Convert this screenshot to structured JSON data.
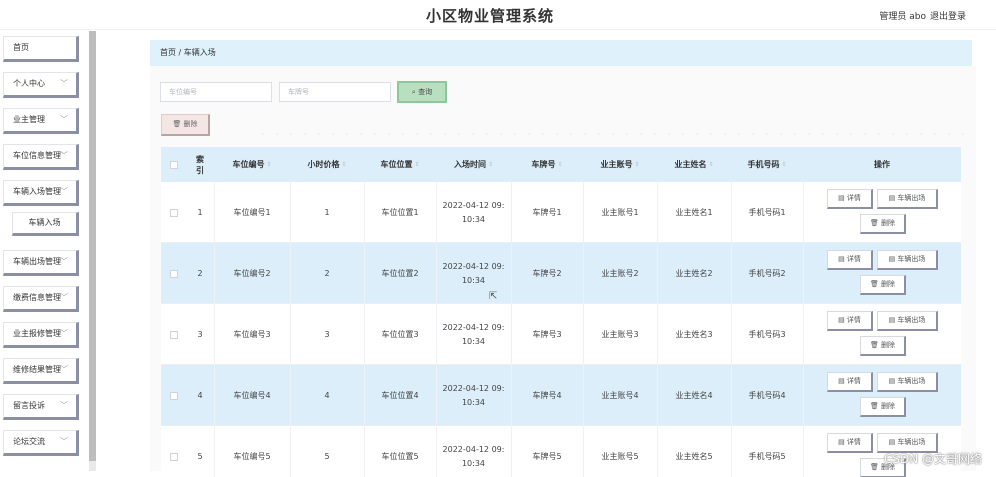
{
  "header": {
    "title": "小区物业管理系统",
    "user": "管理员 abo",
    "logout": "退出登录"
  },
  "sidebar": {
    "items": [
      {
        "label": "首页",
        "chevron": false
      },
      {
        "label": "个人中心",
        "chevron": true
      },
      {
        "label": "业主管理",
        "chevron": true
      },
      {
        "label": "车位信息管理",
        "chevron": true
      },
      {
        "label": "车辆入场管理",
        "chevron": true
      },
      {
        "label": "车辆出场管理",
        "chevron": true
      },
      {
        "label": "缴费信息管理",
        "chevron": true
      },
      {
        "label": "业主报修管理",
        "chevron": true
      },
      {
        "label": "维修结果管理",
        "chevron": true
      },
      {
        "label": "留言投诉",
        "chevron": true
      },
      {
        "label": "论坛交流",
        "chevron": true
      }
    ],
    "subitem": "车辆入场",
    "chevron_glyph": "﹀"
  },
  "breadcrumb": "首页 / 车辆入场",
  "search": {
    "placeholder_space_no": "车位编号",
    "placeholder_plate": "车牌号",
    "button": "⌕ 查询"
  },
  "actions": {
    "delete": "🗑 删除"
  },
  "table": {
    "columns": [
      "",
      "索引",
      "车位编号",
      "小时价格",
      "车位位置",
      "入场时间",
      "车牌号",
      "业主账号",
      "业主姓名",
      "手机号码",
      "操作"
    ],
    "sort_glyph": "⇕",
    "rows": [
      [
        "1",
        "车位编号1",
        "1",
        "车位位置1",
        "2022-04-12 09:\n10:34",
        "车牌号1",
        "业主账号1",
        "业主姓名1",
        "手机号码1"
      ],
      [
        "2",
        "车位编号2",
        "2",
        "车位位置2",
        "2022-04-12 09:\n10:34",
        "车牌号2",
        "业主账号2",
        "业主姓名2",
        "手机号码2"
      ],
      [
        "3",
        "车位编号3",
        "3",
        "车位位置3",
        "2022-04-12 09:\n10:34",
        "车牌号3",
        "业主账号3",
        "业主姓名3",
        "手机号码3"
      ],
      [
        "4",
        "车位编号4",
        "4",
        "车位位置4",
        "2022-04-12 09:\n10:34",
        "车牌号4",
        "业主账号4",
        "业主姓名4",
        "手机号码4"
      ],
      [
        "5",
        "车位编号5",
        "5",
        "车位位置5",
        "2022-04-12 09:\n10:34",
        "车牌号5",
        "业主账号5",
        "业主姓名5",
        "手机号码5"
      ]
    ],
    "ops": {
      "detail": "▤ 详情",
      "exit": "▤ 车辆出场",
      "delete": "🗑 删除"
    }
  },
  "watermark": "CSDN @文哥网络"
}
